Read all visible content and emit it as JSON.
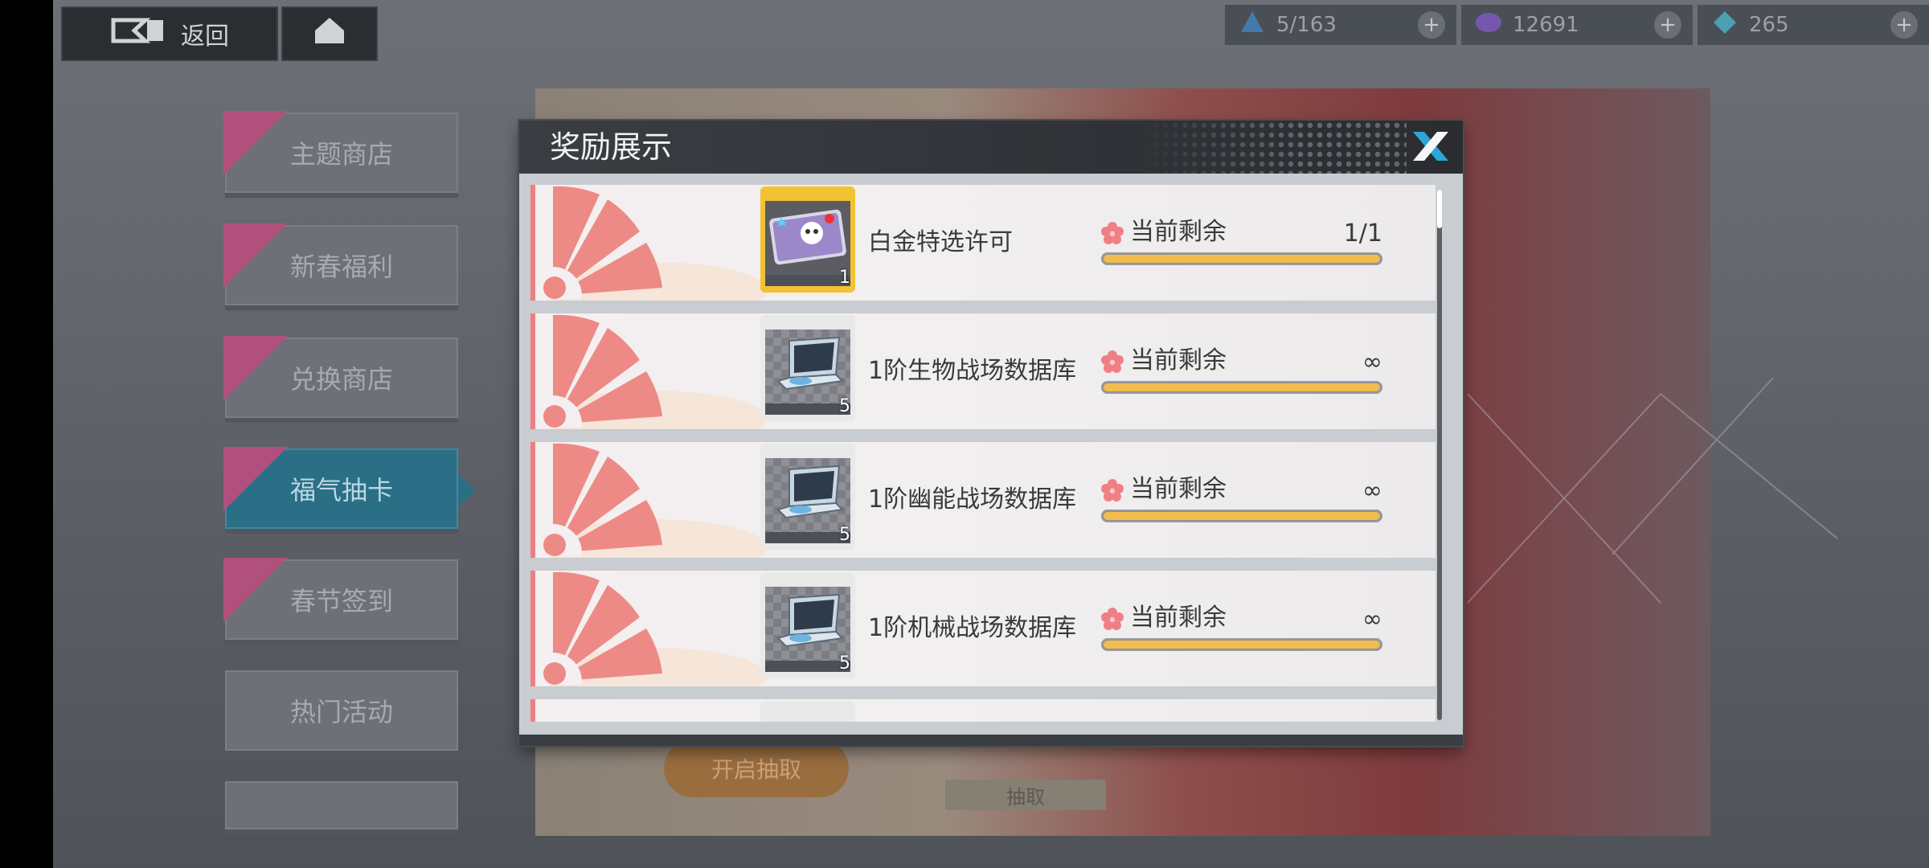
{
  "top_bar": {
    "back_label": "返回",
    "resources": [
      {
        "icon": "stamina-icon",
        "value": "5/163",
        "color": "#3e8fd0"
      },
      {
        "icon": "crystal-icon",
        "value": "12691",
        "color": "#8a5bd3"
      },
      {
        "icon": "diamond-icon",
        "value": "265",
        "color": "#4fc3d6"
      }
    ]
  },
  "sidebar": {
    "items": [
      {
        "label": "主题商店",
        "tagged": true,
        "active": false
      },
      {
        "label": "新春福利",
        "tagged": true,
        "active": false
      },
      {
        "label": "兑换商店",
        "tagged": true,
        "active": false
      },
      {
        "label": "福气抽卡",
        "tagged": true,
        "active": true
      },
      {
        "label": "春节签到",
        "tagged": true,
        "active": false
      },
      {
        "label": "热门活动",
        "tagged": false,
        "active": false
      },
      {
        "label": "",
        "tagged": false,
        "active": false
      }
    ]
  },
  "banner": {
    "button_label": "开启抽取",
    "sub_label": "抽取"
  },
  "dialog": {
    "title": "奖励展示",
    "remaining_label": "当前剩余",
    "accent_color": "#f2bd4e",
    "rows": [
      {
        "name": "白金特选许可",
        "quantity": "1",
        "remaining": "1/1",
        "fill": 1.0,
        "icon": "ticket-icon",
        "rarity": "gold"
      },
      {
        "name": "1阶生物战场数据库",
        "quantity": "5",
        "remaining": "∞",
        "fill": 1.0,
        "icon": "laptop-icon",
        "rarity": "normal"
      },
      {
        "name": "1阶幽能战场数据库",
        "quantity": "5",
        "remaining": "∞",
        "fill": 1.0,
        "icon": "laptop-icon",
        "rarity": "normal"
      },
      {
        "name": "1阶机械战场数据库",
        "quantity": "5",
        "remaining": "∞",
        "fill": 1.0,
        "icon": "laptop-icon",
        "rarity": "normal"
      }
    ]
  }
}
